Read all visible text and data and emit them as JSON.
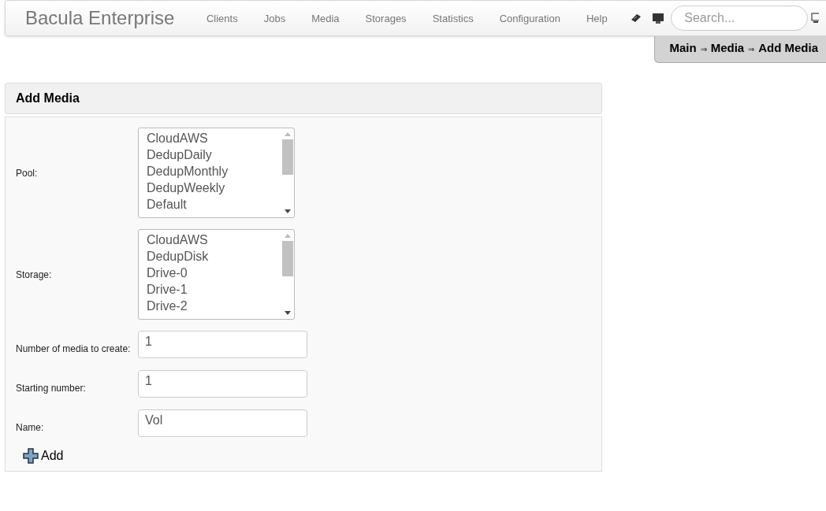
{
  "navbar": {
    "brand": "Bacula Enterprise",
    "menu": [
      "Clients",
      "Jobs",
      "Media",
      "Storages",
      "Statistics",
      "Configuration",
      "Help"
    ],
    "search": {
      "placeholder": "Search..."
    }
  },
  "breadcrumb": [
    "Main",
    "⇒",
    "Media",
    "⇒",
    "Add Media"
  ],
  "panel": {
    "title": "Add Media",
    "fields": [
      {
        "kind": "list",
        "label": "Pool:",
        "options": [
          "CloudAWS",
          "DedupDaily",
          "DedupMonthly",
          "DedupWeekly",
          "Default"
        ]
      },
      {
        "kind": "list",
        "label": "Storage:",
        "options": [
          "CloudAWS",
          "DedupDisk",
          "Drive-0",
          "Drive-1",
          "Drive-2"
        ]
      },
      {
        "kind": "text",
        "label": "Number of media to create:",
        "value": "1"
      },
      {
        "kind": "text",
        "label": "Starting number:",
        "value": "1"
      },
      {
        "kind": "text",
        "label": "Name:",
        "value": "Vol"
      }
    ],
    "button": "Add"
  }
}
